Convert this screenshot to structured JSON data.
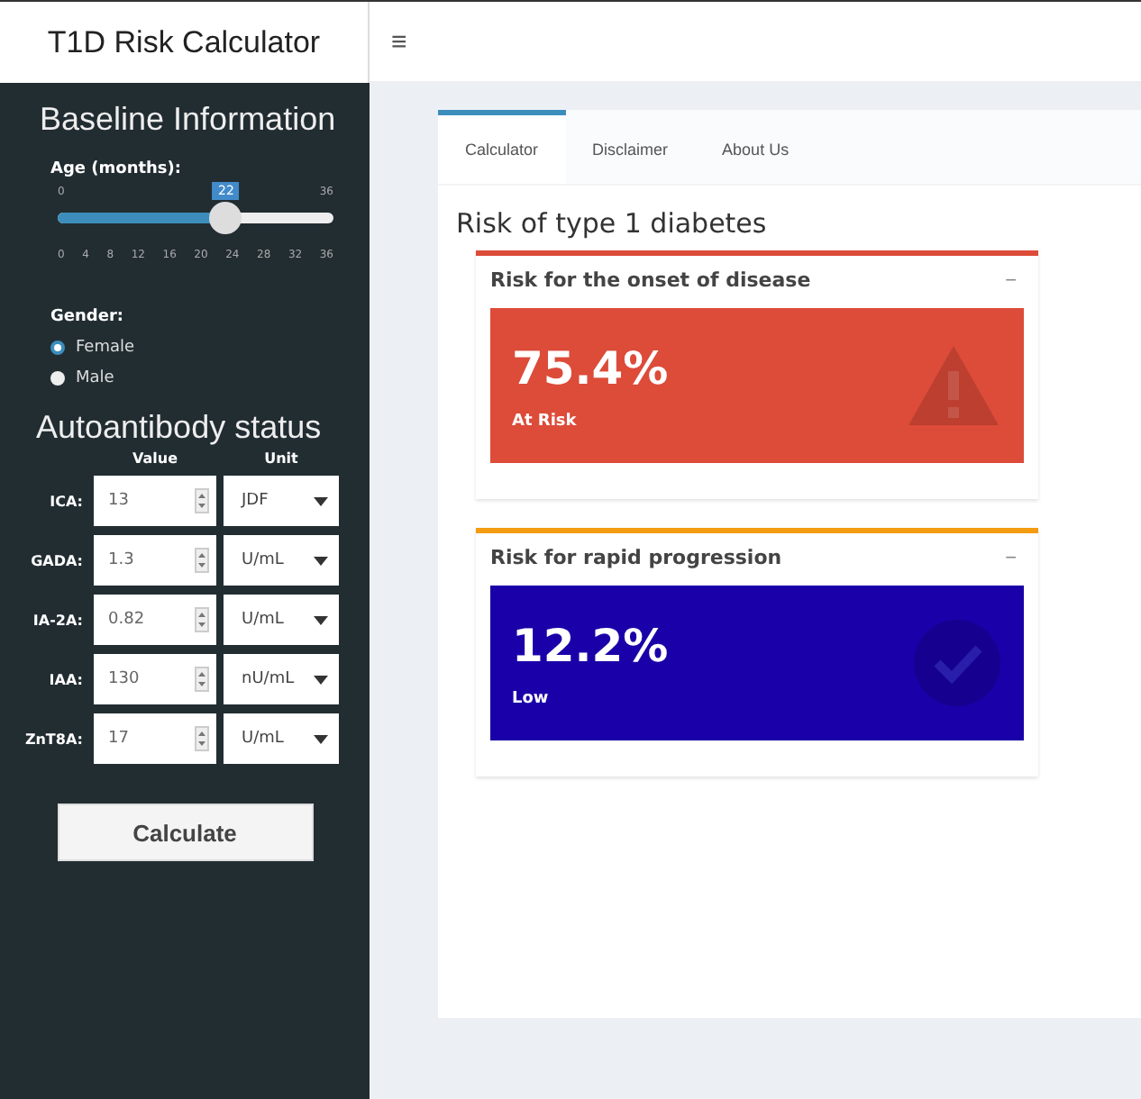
{
  "header": {
    "title": "T1D Risk Calculator",
    "menu_glyph": "≡"
  },
  "sidebar": {
    "baseline_title": "Baseline Information",
    "age": {
      "label": "Age (months):",
      "min": "0",
      "max": "36",
      "value": "22",
      "level": 0.611,
      "ticks": [
        "0",
        "4",
        "8",
        "12",
        "16",
        "20",
        "24",
        "28",
        "32",
        "36"
      ]
    },
    "gender": {
      "label": "Gender:",
      "options": [
        {
          "label": "Female",
          "selected": true
        },
        {
          "label": "Male",
          "selected": false
        }
      ]
    },
    "antibody_title": "Autoantibody status",
    "columns": [
      "Value",
      "Unit"
    ],
    "antibodies": [
      {
        "name": "ICA:",
        "value": "13",
        "unit": "JDF"
      },
      {
        "name": "GADA:",
        "value": "1.3",
        "unit": "U/mL"
      },
      {
        "name": "IA-2A:",
        "value": "0.82",
        "unit": "U/mL"
      },
      {
        "name": "IAA:",
        "value": "130",
        "unit": "nU/mL"
      },
      {
        "name": "ZnT8A:",
        "value": "17",
        "unit": "U/mL"
      }
    ],
    "calculate": "Calculate"
  },
  "tabs": [
    {
      "label": "Calculator",
      "selected": true
    },
    {
      "label": "Disclaimer",
      "selected": false
    },
    {
      "label": "About Us",
      "selected": false
    }
  ],
  "heading": "Risk of type 1 diabetes",
  "boxes": [
    {
      "title": "Risk for the onset of disease",
      "collapse": "−",
      "color": "#dd4b39",
      "value_box": {
        "value": "75.4%",
        "status": "At Risk",
        "color": "#dd4b39",
        "kind": "warning"
      }
    },
    {
      "title": "Risk for rapid progression",
      "collapse": "−",
      "color": "#f39c12",
      "value_box": {
        "value": "12.2%",
        "status": "Low",
        "color": "#1a00a8",
        "kind": "check"
      }
    }
  ]
}
